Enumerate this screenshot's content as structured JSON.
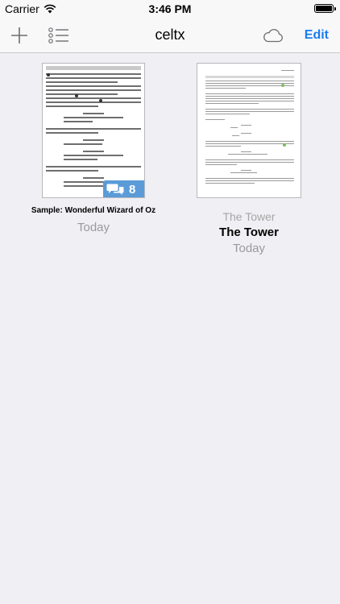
{
  "status_bar": {
    "carrier": "Carrier",
    "time": "3:46 PM"
  },
  "nav": {
    "title": "celtx",
    "edit_label": "Edit",
    "icons": [
      "plus-icon",
      "list-icon",
      "cloud-icon"
    ]
  },
  "documents": [
    {
      "title": "Sample: Wonderful Wizard of Oz",
      "date": "Today",
      "comment_count": "8"
    },
    {
      "title_secondary": "The Tower",
      "title": "The Tower",
      "date": "Today"
    }
  ],
  "colors": {
    "accent": "#1a7cf4",
    "badge": "#5a9bd8",
    "background": "#efeff4"
  }
}
